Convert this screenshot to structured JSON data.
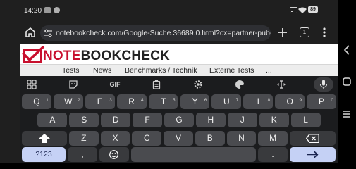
{
  "status_bar": {
    "time": "14:20",
    "battery": "89"
  },
  "browser": {
    "url": "notebookcheck.com/Google-Suche.36689.0.html?cx=partner-pub-",
    "tab_count": "1"
  },
  "page": {
    "logo_prefix": "NOTE",
    "logo_middle": "BOOK",
    "logo_suffix": "CHECK",
    "nav": [
      "Tests",
      "News",
      "Benchmarks / Technik",
      "Externe Tests",
      "..."
    ]
  },
  "keyboard": {
    "gif_label": "GIF",
    "row1": [
      {
        "key": "Q",
        "hint": "1"
      },
      {
        "key": "W",
        "hint": "2"
      },
      {
        "key": "E",
        "hint": "3"
      },
      {
        "key": "R",
        "hint": "4"
      },
      {
        "key": "T",
        "hint": "5"
      },
      {
        "key": "Y",
        "hint": "6"
      },
      {
        "key": "U",
        "hint": "7"
      },
      {
        "key": "I",
        "hint": "8"
      },
      {
        "key": "O",
        "hint": "9"
      },
      {
        "key": "P",
        "hint": "0"
      }
    ],
    "row2": [
      "A",
      "S",
      "D",
      "F",
      "G",
      "H",
      "J",
      "K",
      "L"
    ],
    "row3": [
      "Z",
      "X",
      "C",
      "V",
      "B",
      "N",
      "M"
    ],
    "symbols_label": "?123",
    "comma_label": ",",
    "period_label": "."
  },
  "colors": {
    "accent_key": "#c5d1f5",
    "logo_red": "#c8102e"
  },
  "icons": [
    "home-icon",
    "site-info-icon",
    "plus-icon",
    "tab-count-icon",
    "more-vert-icon",
    "grid-icon",
    "sticker-icon",
    "clipboard-icon",
    "gear-icon",
    "palette-icon",
    "cursor-icon",
    "mic-icon",
    "shift-icon",
    "backspace-icon",
    "emoji-icon",
    "enter-arrow-icon",
    "back-icon",
    "home-square-icon",
    "recents-icon"
  ]
}
